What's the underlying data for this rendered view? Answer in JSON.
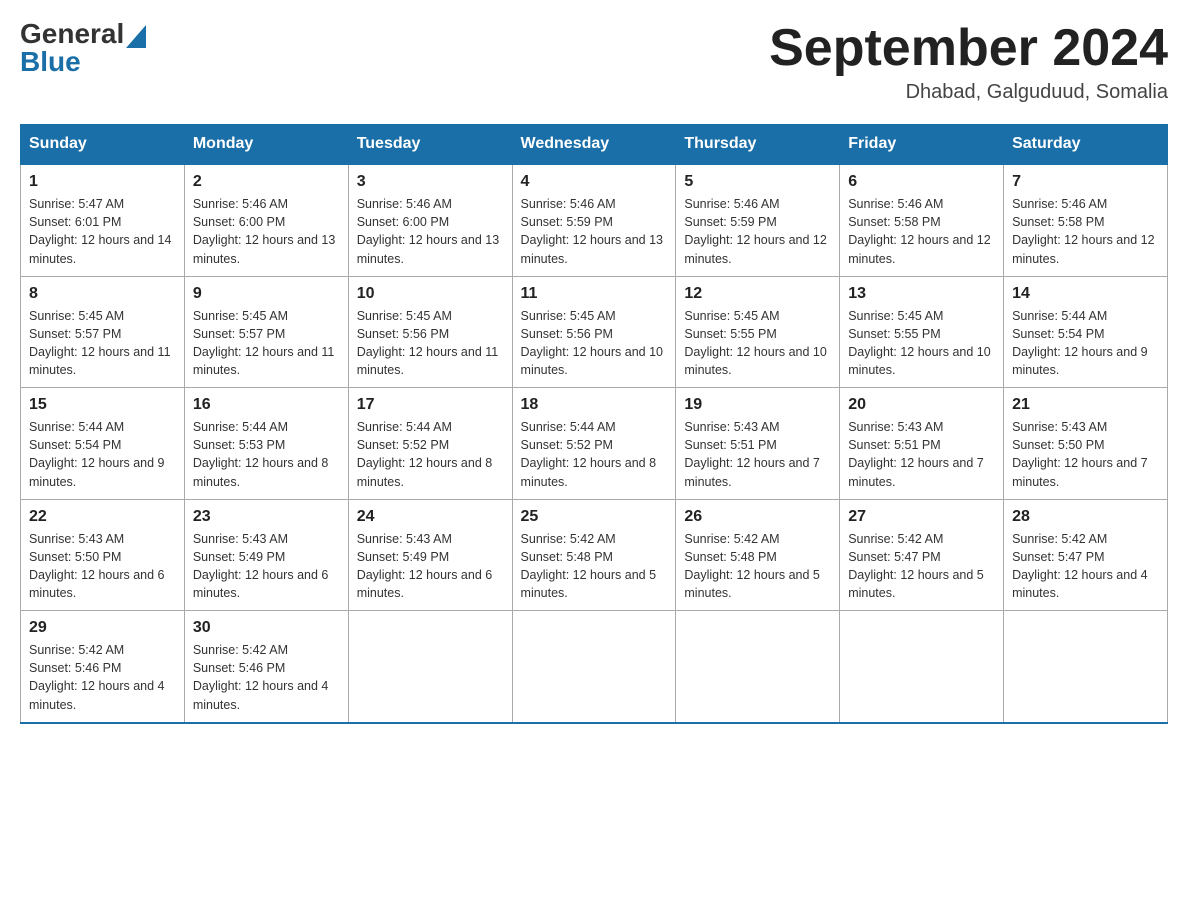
{
  "header": {
    "logo_general": "General",
    "logo_blue": "Blue",
    "page_title": "September 2024",
    "subtitle": "Dhabad, Galguduud, Somalia"
  },
  "days_of_week": [
    "Sunday",
    "Monday",
    "Tuesday",
    "Wednesday",
    "Thursday",
    "Friday",
    "Saturday"
  ],
  "weeks": [
    [
      {
        "day": "1",
        "sunrise": "Sunrise: 5:47 AM",
        "sunset": "Sunset: 6:01 PM",
        "daylight": "Daylight: 12 hours and 14 minutes."
      },
      {
        "day": "2",
        "sunrise": "Sunrise: 5:46 AM",
        "sunset": "Sunset: 6:00 PM",
        "daylight": "Daylight: 12 hours and 13 minutes."
      },
      {
        "day": "3",
        "sunrise": "Sunrise: 5:46 AM",
        "sunset": "Sunset: 6:00 PM",
        "daylight": "Daylight: 12 hours and 13 minutes."
      },
      {
        "day": "4",
        "sunrise": "Sunrise: 5:46 AM",
        "sunset": "Sunset: 5:59 PM",
        "daylight": "Daylight: 12 hours and 13 minutes."
      },
      {
        "day": "5",
        "sunrise": "Sunrise: 5:46 AM",
        "sunset": "Sunset: 5:59 PM",
        "daylight": "Daylight: 12 hours and 12 minutes."
      },
      {
        "day": "6",
        "sunrise": "Sunrise: 5:46 AM",
        "sunset": "Sunset: 5:58 PM",
        "daylight": "Daylight: 12 hours and 12 minutes."
      },
      {
        "day": "7",
        "sunrise": "Sunrise: 5:46 AM",
        "sunset": "Sunset: 5:58 PM",
        "daylight": "Daylight: 12 hours and 12 minutes."
      }
    ],
    [
      {
        "day": "8",
        "sunrise": "Sunrise: 5:45 AM",
        "sunset": "Sunset: 5:57 PM",
        "daylight": "Daylight: 12 hours and 11 minutes."
      },
      {
        "day": "9",
        "sunrise": "Sunrise: 5:45 AM",
        "sunset": "Sunset: 5:57 PM",
        "daylight": "Daylight: 12 hours and 11 minutes."
      },
      {
        "day": "10",
        "sunrise": "Sunrise: 5:45 AM",
        "sunset": "Sunset: 5:56 PM",
        "daylight": "Daylight: 12 hours and 11 minutes."
      },
      {
        "day": "11",
        "sunrise": "Sunrise: 5:45 AM",
        "sunset": "Sunset: 5:56 PM",
        "daylight": "Daylight: 12 hours and 10 minutes."
      },
      {
        "day": "12",
        "sunrise": "Sunrise: 5:45 AM",
        "sunset": "Sunset: 5:55 PM",
        "daylight": "Daylight: 12 hours and 10 minutes."
      },
      {
        "day": "13",
        "sunrise": "Sunrise: 5:45 AM",
        "sunset": "Sunset: 5:55 PM",
        "daylight": "Daylight: 12 hours and 10 minutes."
      },
      {
        "day": "14",
        "sunrise": "Sunrise: 5:44 AM",
        "sunset": "Sunset: 5:54 PM",
        "daylight": "Daylight: 12 hours and 9 minutes."
      }
    ],
    [
      {
        "day": "15",
        "sunrise": "Sunrise: 5:44 AM",
        "sunset": "Sunset: 5:54 PM",
        "daylight": "Daylight: 12 hours and 9 minutes."
      },
      {
        "day": "16",
        "sunrise": "Sunrise: 5:44 AM",
        "sunset": "Sunset: 5:53 PM",
        "daylight": "Daylight: 12 hours and 8 minutes."
      },
      {
        "day": "17",
        "sunrise": "Sunrise: 5:44 AM",
        "sunset": "Sunset: 5:52 PM",
        "daylight": "Daylight: 12 hours and 8 minutes."
      },
      {
        "day": "18",
        "sunrise": "Sunrise: 5:44 AM",
        "sunset": "Sunset: 5:52 PM",
        "daylight": "Daylight: 12 hours and 8 minutes."
      },
      {
        "day": "19",
        "sunrise": "Sunrise: 5:43 AM",
        "sunset": "Sunset: 5:51 PM",
        "daylight": "Daylight: 12 hours and 7 minutes."
      },
      {
        "day": "20",
        "sunrise": "Sunrise: 5:43 AM",
        "sunset": "Sunset: 5:51 PM",
        "daylight": "Daylight: 12 hours and 7 minutes."
      },
      {
        "day": "21",
        "sunrise": "Sunrise: 5:43 AM",
        "sunset": "Sunset: 5:50 PM",
        "daylight": "Daylight: 12 hours and 7 minutes."
      }
    ],
    [
      {
        "day": "22",
        "sunrise": "Sunrise: 5:43 AM",
        "sunset": "Sunset: 5:50 PM",
        "daylight": "Daylight: 12 hours and 6 minutes."
      },
      {
        "day": "23",
        "sunrise": "Sunrise: 5:43 AM",
        "sunset": "Sunset: 5:49 PM",
        "daylight": "Daylight: 12 hours and 6 minutes."
      },
      {
        "day": "24",
        "sunrise": "Sunrise: 5:43 AM",
        "sunset": "Sunset: 5:49 PM",
        "daylight": "Daylight: 12 hours and 6 minutes."
      },
      {
        "day": "25",
        "sunrise": "Sunrise: 5:42 AM",
        "sunset": "Sunset: 5:48 PM",
        "daylight": "Daylight: 12 hours and 5 minutes."
      },
      {
        "day": "26",
        "sunrise": "Sunrise: 5:42 AM",
        "sunset": "Sunset: 5:48 PM",
        "daylight": "Daylight: 12 hours and 5 minutes."
      },
      {
        "day": "27",
        "sunrise": "Sunrise: 5:42 AM",
        "sunset": "Sunset: 5:47 PM",
        "daylight": "Daylight: 12 hours and 5 minutes."
      },
      {
        "day": "28",
        "sunrise": "Sunrise: 5:42 AM",
        "sunset": "Sunset: 5:47 PM",
        "daylight": "Daylight: 12 hours and 4 minutes."
      }
    ],
    [
      {
        "day": "29",
        "sunrise": "Sunrise: 5:42 AM",
        "sunset": "Sunset: 5:46 PM",
        "daylight": "Daylight: 12 hours and 4 minutes."
      },
      {
        "day": "30",
        "sunrise": "Sunrise: 5:42 AM",
        "sunset": "Sunset: 5:46 PM",
        "daylight": "Daylight: 12 hours and 4 minutes."
      },
      null,
      null,
      null,
      null,
      null
    ]
  ]
}
